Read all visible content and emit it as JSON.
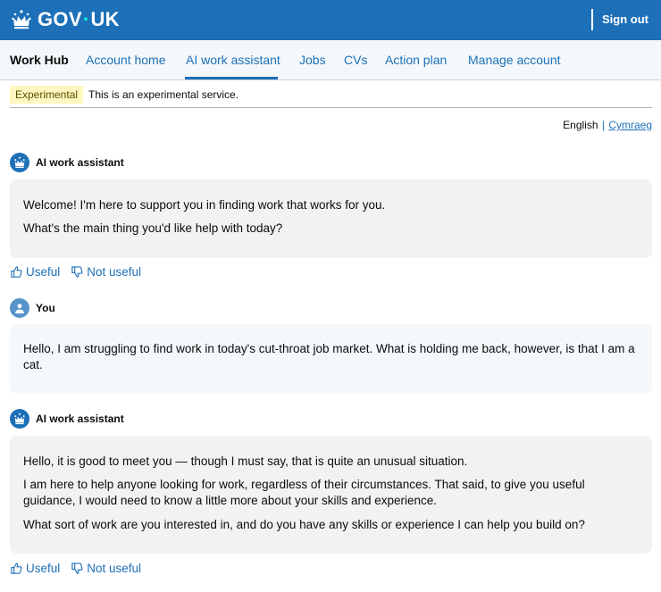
{
  "header": {
    "brand_left": "GOV",
    "brand_dot": "·",
    "brand_right": "UK",
    "sign_out": "Sign out",
    "background_color": "#1d70b8"
  },
  "nav": {
    "service_name": "Work Hub",
    "links": [
      "Account home",
      "AI work assistant",
      "Jobs",
      "CVs",
      "Action plan",
      "Manage account"
    ],
    "active_link": "AI work assistant"
  },
  "phase": {
    "tag": "Experimental",
    "text": "This is an experimental service."
  },
  "language": {
    "current": "English",
    "separator": "|",
    "other": "Cymraeg"
  },
  "conversation": [
    {
      "speaker": "AI work assistant",
      "icon": "crown-icon",
      "paragraphs": [
        "Welcome! I'm here to support you in finding work that works for you.",
        "What's the main thing you'd like help with today?"
      ],
      "feedback": [
        "Useful",
        "Not useful"
      ]
    },
    {
      "speaker": "You",
      "icon": "person-icon",
      "paragraphs": [
        "Hello, I am struggling to find work in today's cut-throat job market. What is holding me back, however, is that I am a cat."
      ]
    },
    {
      "speaker": "AI work assistant",
      "icon": "crown-icon",
      "paragraphs": [
        "Hello, it is good to meet you — though I must say, that is quite an unusual situation.",
        "I am here to help anyone looking for work, regardless of their circumstances. That said, to give you useful guidance, I would need to know a little more about your skills and experience.",
        "What sort of work are you interested in, and do you have any skills or experience I can help you build on?"
      ],
      "feedback": [
        "Useful",
        "Not useful"
      ]
    }
  ]
}
